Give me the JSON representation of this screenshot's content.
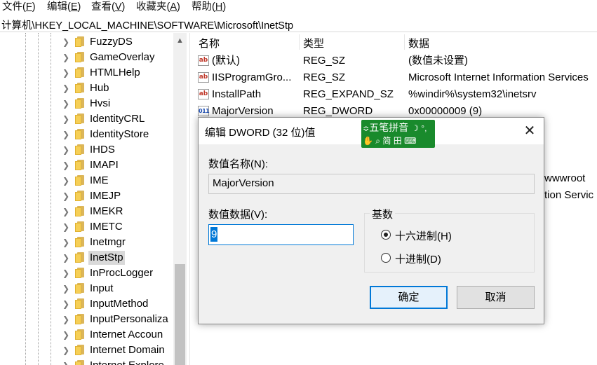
{
  "menubar": {
    "items": [
      {
        "label": "文件(",
        "key": "F",
        "end": ")"
      },
      {
        "label": "编辑(",
        "key": "E",
        "end": ")"
      },
      {
        "label": "查看(",
        "key": "V",
        "end": ")"
      },
      {
        "label": "收藏夹(",
        "key": "A",
        "end": ")"
      },
      {
        "label": "帮助(",
        "key": "H",
        "end": ")"
      }
    ]
  },
  "address": "计算机\\HKEY_LOCAL_MACHINE\\SOFTWARE\\Microsoft\\InetStp",
  "tree": {
    "items": [
      {
        "label": "FuzzyDS"
      },
      {
        "label": "GameOverlay"
      },
      {
        "label": "HTMLHelp"
      },
      {
        "label": "Hub"
      },
      {
        "label": "Hvsi"
      },
      {
        "label": "IdentityCRL"
      },
      {
        "label": "IdentityStore"
      },
      {
        "label": "IHDS"
      },
      {
        "label": "IMAPI"
      },
      {
        "label": "IME"
      },
      {
        "label": "IMEJP"
      },
      {
        "label": "IMEKR"
      },
      {
        "label": "IMETC"
      },
      {
        "label": "Inetmgr"
      },
      {
        "label": "InetStp",
        "selected": true
      },
      {
        "label": "InProcLogger"
      },
      {
        "label": "Input"
      },
      {
        "label": "InputMethod"
      },
      {
        "label": "InputPersonaliza"
      },
      {
        "label": "Internet Accoun"
      },
      {
        "label": "Internet Domain"
      },
      {
        "label": "Internet Explore"
      }
    ]
  },
  "list": {
    "columns": [
      "名称",
      "类型",
      "数据"
    ],
    "rows": [
      {
        "icon": "ab",
        "name": "(默认)",
        "type": "REG_SZ",
        "data": "(数值未设置)"
      },
      {
        "icon": "ab",
        "name": "IISProgramGro...",
        "type": "REG_SZ",
        "data": "Microsoft Internet Information Services"
      },
      {
        "icon": "ab",
        "name": "InstallPath",
        "type": "REG_EXPAND_SZ",
        "data": "%windir%\\system32\\inetsrv"
      },
      {
        "icon": "011",
        "name": "MajorVersion",
        "type": "REG_DWORD",
        "data": "0x00000009 (9)"
      }
    ],
    "partial_texts": [
      "wwwroot",
      "tion Servic"
    ]
  },
  "dialog": {
    "title": "编辑 DWORD (32 位)值",
    "close_glyph": "✕",
    "value_name_label": "数值名称(N):",
    "value_name": "MajorVersion",
    "value_data_label": "数值数据(V):",
    "value_data": "9",
    "base_label": "基数",
    "radix_options": [
      {
        "label": "十六进制(H)",
        "selected": true
      },
      {
        "label": "十进制(D)",
        "selected": false
      }
    ],
    "ok_label": "确定",
    "cancel_label": "取消"
  },
  "ime": {
    "row1": "五笔拼音",
    "row1_icons": "☽ °,",
    "row2_text": "简 田",
    "icons": [
      "hand-icon",
      "search-icon",
      "keyboard-icon"
    ]
  },
  "colors": {
    "accent": "#0078d7",
    "ime_green": "#198a2c",
    "selection": "#d9d9d9"
  }
}
